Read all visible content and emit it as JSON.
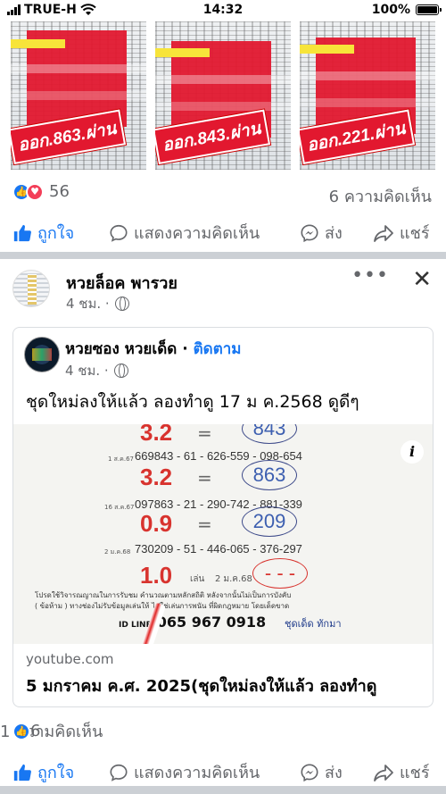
{
  "status": {
    "carrier": "TRUE-H",
    "time": "14:32",
    "battery": "100%"
  },
  "prev_post": {
    "images": [
      {
        "stamp": "ออก.863.ผ่าน"
      },
      {
        "stamp": "ออก.843.ผ่าน"
      },
      {
        "stamp": "ออก.221.ผ่าน"
      }
    ],
    "reaction_count": "56",
    "comment_count": "6 ความคิดเห็น"
  },
  "actions": {
    "like": "ถูกใจ",
    "comment": "แสดงความคิดเห็น",
    "send": "ส่ง",
    "share": "แชร์"
  },
  "post": {
    "author": "หวยล็อค พารวย",
    "time": "4 ชม. ·",
    "shared": {
      "author": "หวยซอง หวยเด็ด",
      "separator": "·",
      "follow": "ติดตาม",
      "time": "4 ชม. ·",
      "text": "ชุดใหม่ลงให้แล้ว ลองทำดู 17 ม ค.2568 ดูดีๆ",
      "video": {
        "rows": [
          {
            "big": "3.2",
            "eq": "=",
            "circle": "843",
            "date": "",
            "nums": ""
          },
          {
            "big": "",
            "eq": "",
            "circle": "",
            "date": "1 ส.ค.67",
            "nums": "669843 - 61 - 626-559 - 098-654"
          },
          {
            "big": "3.2",
            "eq": "=",
            "circle": "863",
            "date": "16 ส.ค.67",
            "nums": "097863 - 21 - 290-742 - 881-339"
          },
          {
            "big": "0.9",
            "eq": "=",
            "circle": "209",
            "date": "2 ม.ค.68",
            "nums": "730209 - 51 - 446-065 - 376-297"
          }
        ],
        "next": {
          "big": "1.0",
          "label": "เล่น",
          "date": "2 ม.ค.68",
          "circle": "- - -"
        },
        "footer_1": "โปรดใช้วิจารณญาณในการรับชม คำนวณตามหลักสถิติ หลังจากนั้นไม่เป็นการบังคับ",
        "footer_2": "( ข้อห้าม ) ทางช่องไม่รับข้อมูลเล่นให้ ไม่ใช่เล่นการพนัน ที่ผิดกฎหมาย โดยเด็ดขาด",
        "id_label": "ID LINE",
        "id_number": "065 967 0918",
        "signature": "ชุดเด็ด ทักมา",
        "info": "i"
      },
      "source": "youtube.com",
      "title": "5 มกราคม ค.ศ. 2025(ชุดใหม่ลงให้แล้ว ลองทำดู"
    },
    "reaction_count": "6",
    "comment_count": "1 ความคิดเห็น"
  },
  "colors": {
    "brand_blue": "#1877f2",
    "love_red": "#f33e58",
    "stamp_red": "#e2182f"
  }
}
